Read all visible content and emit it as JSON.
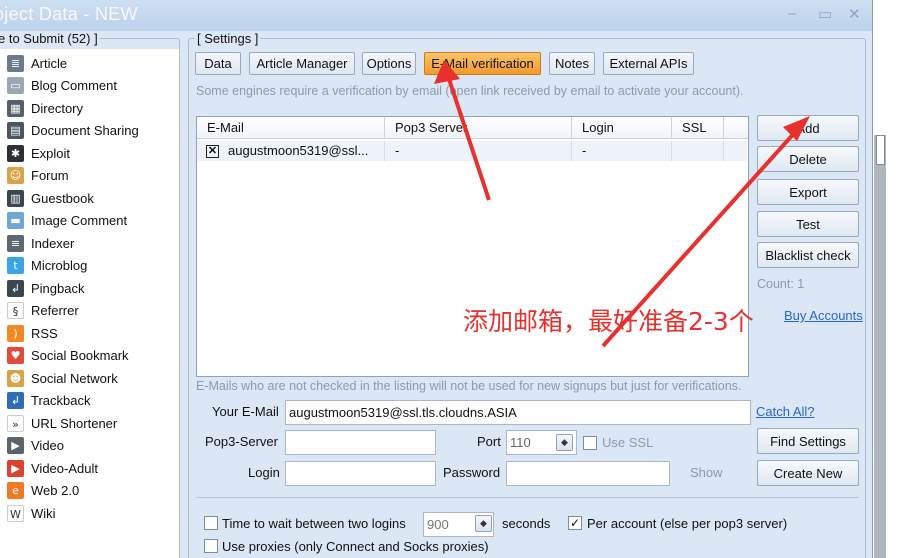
{
  "window": {
    "title": "oject Data - NEW",
    "controls": [
      "–",
      "▭",
      "✕"
    ]
  },
  "left": {
    "legend": "e to Submit  (52) ]",
    "categories": [
      {
        "label": "Article",
        "icon": "article-icon",
        "color": "#6b7b8c",
        "glyph": "≣"
      },
      {
        "label": "Blog Comment",
        "icon": "blog-comment-icon",
        "color": "#9aa7b5",
        "glyph": "▭"
      },
      {
        "label": "Directory",
        "icon": "directory-icon",
        "color": "#55606c",
        "glyph": "▦"
      },
      {
        "label": "Document Sharing",
        "icon": "document-sharing-icon",
        "color": "#4c5663",
        "glyph": "▤"
      },
      {
        "label": "Exploit",
        "icon": "exploit-icon",
        "color": "#2d3136",
        "glyph": "✱"
      },
      {
        "label": "Forum",
        "icon": "forum-icon",
        "color": "#d9a34a",
        "glyph": "☺"
      },
      {
        "label": "Guestbook",
        "icon": "guestbook-icon",
        "color": "#3d4550",
        "glyph": "▥"
      },
      {
        "label": "Image Comment",
        "icon": "image-comment-icon",
        "color": "#6fa8d8",
        "glyph": "▬"
      },
      {
        "label": "Indexer",
        "icon": "indexer-icon",
        "color": "#5d6873",
        "glyph": "≡"
      },
      {
        "label": "Microblog",
        "icon": "microblog-icon",
        "color": "#39a5e6",
        "glyph": "t"
      },
      {
        "label": "Pingback",
        "icon": "pingback-icon",
        "color": "#3d4550",
        "glyph": "↲"
      },
      {
        "label": "Referrer",
        "icon": "referrer-icon",
        "color": "#ffffff",
        "glyph": "§"
      },
      {
        "label": "RSS",
        "icon": "rss-icon",
        "color": "#f08a24",
        "glyph": ")"
      },
      {
        "label": "Social Bookmark",
        "icon": "social-bookmark-icon",
        "color": "#e04b3c",
        "glyph": "♥"
      },
      {
        "label": "Social Network",
        "icon": "social-network-icon",
        "color": "#d9a34a",
        "glyph": "☻"
      },
      {
        "label": "Trackback",
        "icon": "trackback-icon",
        "color": "#2f6db5",
        "glyph": "↲"
      },
      {
        "label": "URL Shortener",
        "icon": "url-shortener-icon",
        "color": "#ffffff",
        "glyph": "»"
      },
      {
        "label": "Video",
        "icon": "video-icon",
        "color": "#5b636d",
        "glyph": "▶"
      },
      {
        "label": "Video-Adult",
        "icon": "video-adult-icon",
        "color": "#d9452c",
        "glyph": "▶"
      },
      {
        "label": "Web 2.0",
        "icon": "web20-icon",
        "color": "#f07a24",
        "glyph": "e"
      },
      {
        "label": "Wiki",
        "icon": "wiki-icon",
        "color": "#ffffff",
        "glyph": "W"
      }
    ]
  },
  "settings": {
    "legend": "[ Settings ]",
    "tabs": [
      {
        "label": "Data"
      },
      {
        "label": "Article Manager"
      },
      {
        "label": "Options"
      },
      {
        "label": "E-Mail verification"
      },
      {
        "label": "Notes"
      },
      {
        "label": "External APIs"
      }
    ],
    "active_tab": "E-Mail verification",
    "note_top": "Some engines require a verification by email (open link received by email to activate your account).",
    "table": {
      "columns": [
        "E-Mail",
        "Pop3 Server",
        "Login",
        "SSL"
      ],
      "rows": [
        {
          "checked": true,
          "check_glyph": "✕",
          "email": "augustmoon5319@ssl...",
          "pop3": "-",
          "login": "-",
          "ssl": ""
        }
      ]
    },
    "buttons": {
      "add": "Add",
      "delete": "Delete",
      "export": "Export",
      "test": "Test",
      "blacklist": "Blacklist check"
    },
    "count": "Count: 1",
    "buy_accounts": "Buy Accounts",
    "note_bottom": "E-Mails who are not checked in the listing will not be used for new signups but just for verifications.",
    "form": {
      "your_email_label": "Your E-Mail",
      "your_email_value": "augustmoon5319@ssl.tls.cloudns.ASIA",
      "catch_all": "Catch All?",
      "pop3_label": "Pop3-Server",
      "pop3_value": "",
      "port_label": "Port",
      "port_value": "110",
      "use_ssl": "Use SSL",
      "login_label": "Login",
      "login_value": "",
      "password_label": "Password",
      "password_value": "",
      "show": "Show",
      "find_settings": "Find Settings",
      "create_new": "Create New"
    },
    "options": {
      "time_wait_label": "Time to wait between two logins",
      "time_wait_value": "900",
      "seconds": "seconds",
      "per_account_label": "Per account (else per pop3 server)",
      "per_account_checked": true,
      "use_proxies_label": "Use proxies (only Connect and Socks proxies)",
      "use_proxies_checked": false
    }
  },
  "annotation": {
    "text": "添加邮箱，最好准备2-3个",
    "color": "#e8302c"
  }
}
